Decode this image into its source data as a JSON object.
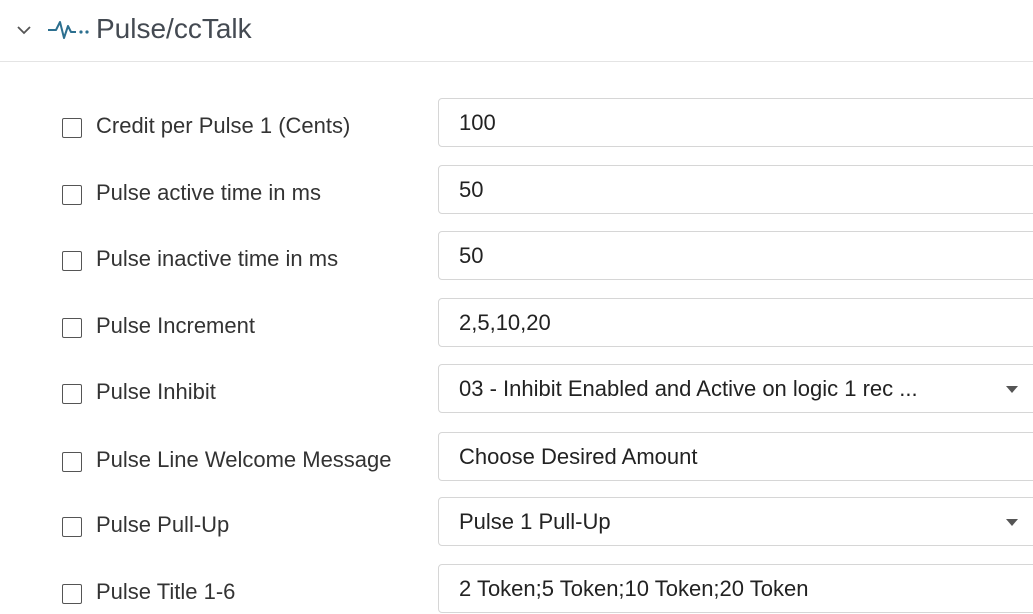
{
  "section": {
    "title": "Pulse/ccTalk",
    "icons": {
      "collapse": "chevron-down-icon",
      "pulse": "pulse-waveform-icon"
    }
  },
  "settings": [
    {
      "label": "Credit per Pulse 1 (Cents)",
      "value": "100",
      "kind": "text"
    },
    {
      "label": "Pulse active time in ms",
      "value": "50",
      "kind": "text"
    },
    {
      "label": "Pulse inactive time in ms",
      "value": "50",
      "kind": "text"
    },
    {
      "label": "Pulse Increment",
      "value": "2,5,10,20",
      "kind": "text"
    },
    {
      "label": "Pulse Inhibit",
      "value": "03 - Inhibit Enabled and Active on logic 1 rec ...",
      "kind": "select"
    },
    {
      "label": "Pulse Line Welcome Message",
      "value": "Choose Desired Amount",
      "kind": "text"
    },
    {
      "label": "Pulse Pull-Up",
      "value": "Pulse 1 Pull-Up",
      "kind": "select"
    },
    {
      "label": "Pulse Title 1-6",
      "value": "2 Token;5 Token;10 Token;20 Token",
      "kind": "text"
    }
  ],
  "colors": {
    "accent": "#2c6f8f",
    "border": "#d6d6d6",
    "divider": "#e4e4e4"
  }
}
